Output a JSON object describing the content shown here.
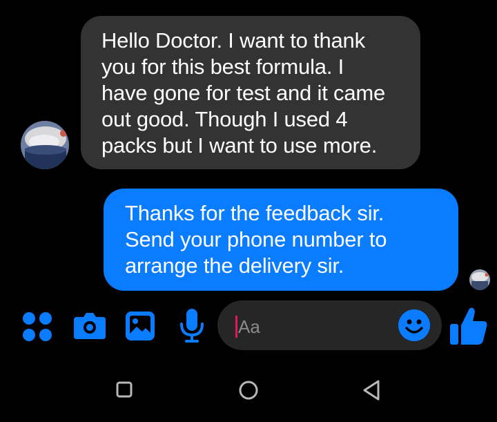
{
  "conversation": {
    "incoming_message": {
      "text": "Hello Doctor. I want to thank\nyou for this best formula. I\nhave gone for test and it came\nout good. Though I used 4\npacks but I want to use more."
    },
    "outgoing_message": {
      "text": "Thanks for the feedback sir.\nSend your phone number to\narrange the delivery sir."
    }
  },
  "composer": {
    "placeholder": "Aa",
    "icons": {
      "more": "apps-grid-icon",
      "camera": "camera-icon",
      "gallery": "gallery-icon",
      "microphone": "microphone-icon",
      "emoji": "emoji-icon",
      "like": "thumbs-up-icon"
    }
  },
  "navigation": {
    "icons": [
      "recent-apps-icon",
      "home-icon",
      "back-icon"
    ]
  },
  "colors": {
    "background": "#000000",
    "incoming_bubble": "#333333",
    "outgoing_bubble": "#0a7cff",
    "accent": "#0a7cff",
    "input_background": "#262626",
    "caret": "#e5175e",
    "nav_icons": "#b8b8b8"
  }
}
